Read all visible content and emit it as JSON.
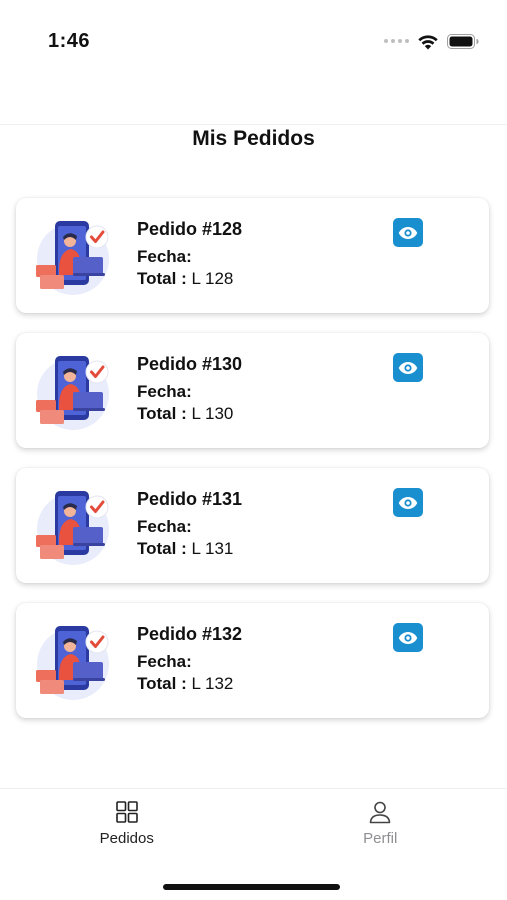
{
  "status_bar": {
    "time": "1:46"
  },
  "page": {
    "title": "Mis Pedidos"
  },
  "orders": [
    {
      "title": "Pedido #128",
      "fecha_label": "Fecha:",
      "total_label": "Total :",
      "total_value": "L 128"
    },
    {
      "title": "Pedido #130",
      "fecha_label": "Fecha:",
      "total_label": "Total :",
      "total_value": "L 130"
    },
    {
      "title": "Pedido #131",
      "fecha_label": "Fecha:",
      "total_label": "Total :",
      "total_value": "L 131"
    },
    {
      "title": "Pedido #132",
      "fecha_label": "Fecha:",
      "total_label": "Total :",
      "total_value": "L 132"
    }
  ],
  "icons": {
    "order_illustration": "person-with-phone-check-illustration",
    "view_button": "eye-icon",
    "tab_pedidos": "grid-icon",
    "tab_perfil": "person-icon"
  },
  "tab_bar": {
    "tabs": [
      {
        "label": "Pedidos",
        "active": true
      },
      {
        "label": "Perfil",
        "active": false
      }
    ]
  },
  "colors": {
    "accent": "#1a8fd0",
    "text": "#111111",
    "inactive_tab": "#8e8e93"
  }
}
